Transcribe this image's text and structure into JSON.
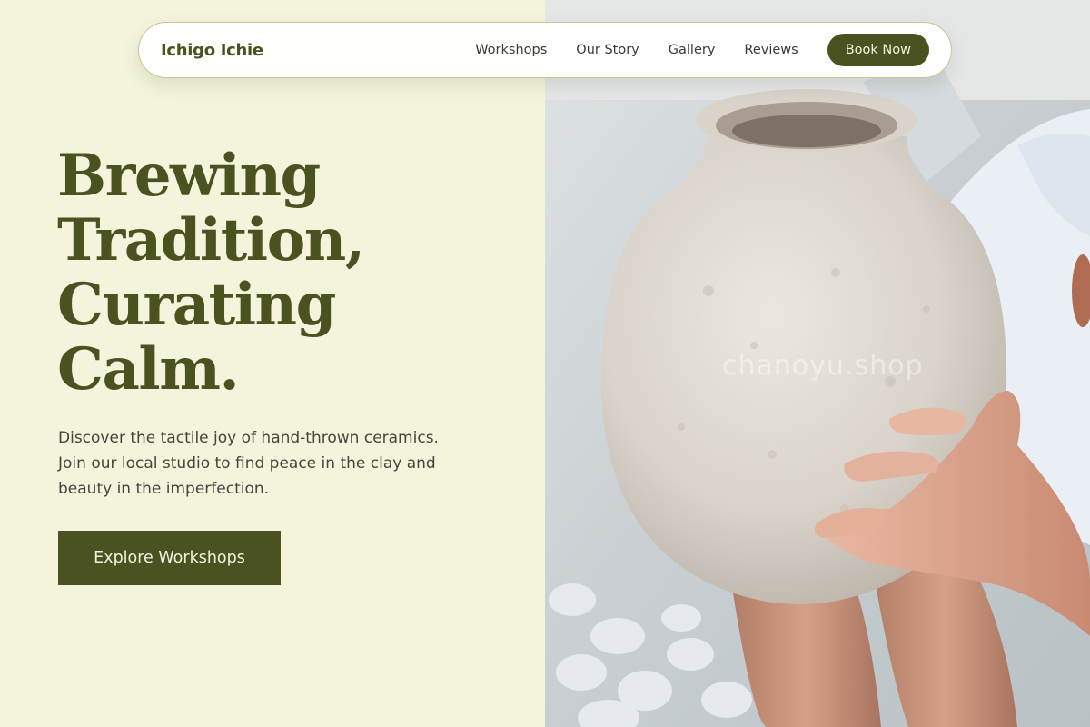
{
  "nav": {
    "brand": "Ichigo Ichie",
    "links": [
      "Workshops",
      "Our Story",
      "Gallery",
      "Reviews"
    ],
    "cta": "Book Now"
  },
  "hero": {
    "title_lines": [
      "Brewing",
      "Tradition,",
      "Curating",
      "Calm."
    ],
    "description": "Discover the tactile joy of hand-thrown ceramics. Join our local studio to find peace in the clay and beauty in the imperfection.",
    "cta": "Explore Workshops"
  },
  "photo": {
    "watermark": "chanoyu.shop"
  },
  "colors": {
    "background": "#f4f4dc",
    "accent": "#4a5320",
    "text": "#45453f",
    "button_text": "#f3f1df"
  }
}
